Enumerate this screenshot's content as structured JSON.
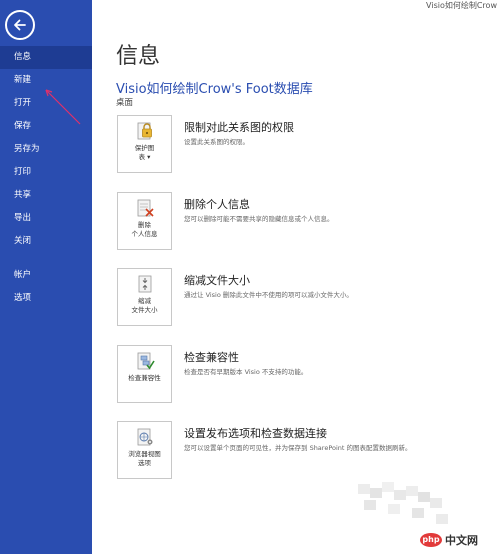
{
  "window": {
    "doc_title": "Visio如何绘制Crow"
  },
  "sidebar": {
    "items": [
      {
        "label": "信息",
        "selected": true
      },
      {
        "label": "新建"
      },
      {
        "label": "打开"
      },
      {
        "label": "保存"
      },
      {
        "label": "另存为"
      },
      {
        "label": "打印"
      },
      {
        "label": "共享"
      },
      {
        "label": "导出"
      },
      {
        "label": "关闭"
      },
      {
        "label": "帐户"
      },
      {
        "label": "选项"
      }
    ]
  },
  "main": {
    "title": "信息",
    "file_title": "Visio如何绘制Crow's Foot数据库",
    "location": "桌面",
    "actions": [
      {
        "tile_label": "保护图\n表 ▾",
        "title": "限制对此关系图的权限",
        "desc": "设置此关系图的权限。",
        "icon": "lock-icon"
      },
      {
        "tile_label": "删除\n个人信息",
        "title": "删除个人信息",
        "desc": "您可以删除可能不需要共享的隐藏信息或个人信息。",
        "icon": "remove-info-icon"
      },
      {
        "tile_label": "缩减\n文件大小",
        "title": "缩减文件大小",
        "desc": "通过让 Visio 删除此文件中不使用的项可以减小文件大小。",
        "icon": "compress-icon"
      },
      {
        "tile_label": "检查兼容性",
        "title": "检查兼容性",
        "desc": "检查是否有早期版本 Visio 不支持的功能。",
        "icon": "compatibility-icon"
      },
      {
        "tile_label": "浏览器视图\n选项",
        "title": "设置发布选项和检查数据连接",
        "desc": "您可以设置单个页面的可见性，并为保存到 SharePoint 的图表配置数据刷新。",
        "icon": "browser-view-icon"
      }
    ]
  },
  "watermark": {
    "badge": "php",
    "text": "中文网"
  },
  "colors": {
    "sidebar": "#2a4db0",
    "selected": "#1e3c93",
    "accent": "#2a4db0"
  }
}
